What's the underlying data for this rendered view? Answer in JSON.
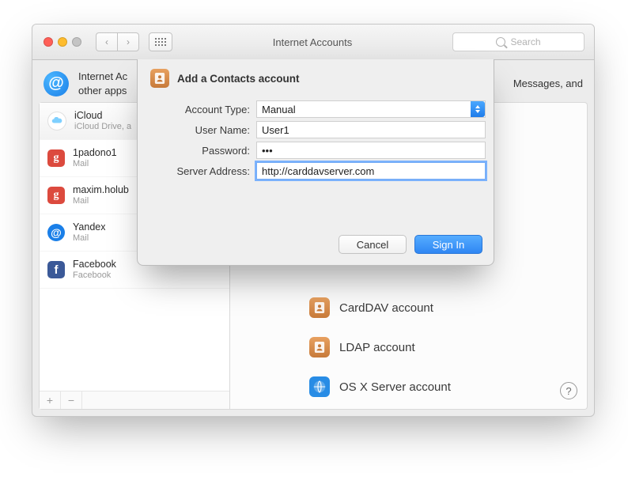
{
  "window_title": "Internet Accounts",
  "search_placeholder": "Search",
  "summary_line1": "Internet Ac",
  "summary_line2": "other apps",
  "summary_tail": "Messages, and",
  "sidebar": {
    "accounts": [
      {
        "title": "iCloud",
        "sub": "iCloud Drive, a",
        "kind": "icloud"
      },
      {
        "title": "1padono1",
        "sub": "Mail",
        "kind": "google"
      },
      {
        "title": "maxim.holub",
        "sub": "Mail",
        "kind": "google"
      },
      {
        "title": "Yandex",
        "sub": "Mail",
        "kind": "at"
      },
      {
        "title": "Facebook",
        "sub": "Facebook",
        "kind": "facebook"
      }
    ]
  },
  "providers": {
    "carddav_label": "CardDAV account",
    "ldap_label": "LDAP account",
    "osx_label": "OS X Server account"
  },
  "sheet": {
    "title": "Add a Contacts account",
    "labels": {
      "account_type": "Account Type:",
      "user_name": "User Name:",
      "password": "Password:",
      "server_address": "Server Address:"
    },
    "values": {
      "account_type": "Manual",
      "user_name": "User1",
      "password_masked": "•••",
      "server_address": "http://carddavserver.com"
    },
    "buttons": {
      "cancel": "Cancel",
      "signin": "Sign In"
    }
  }
}
